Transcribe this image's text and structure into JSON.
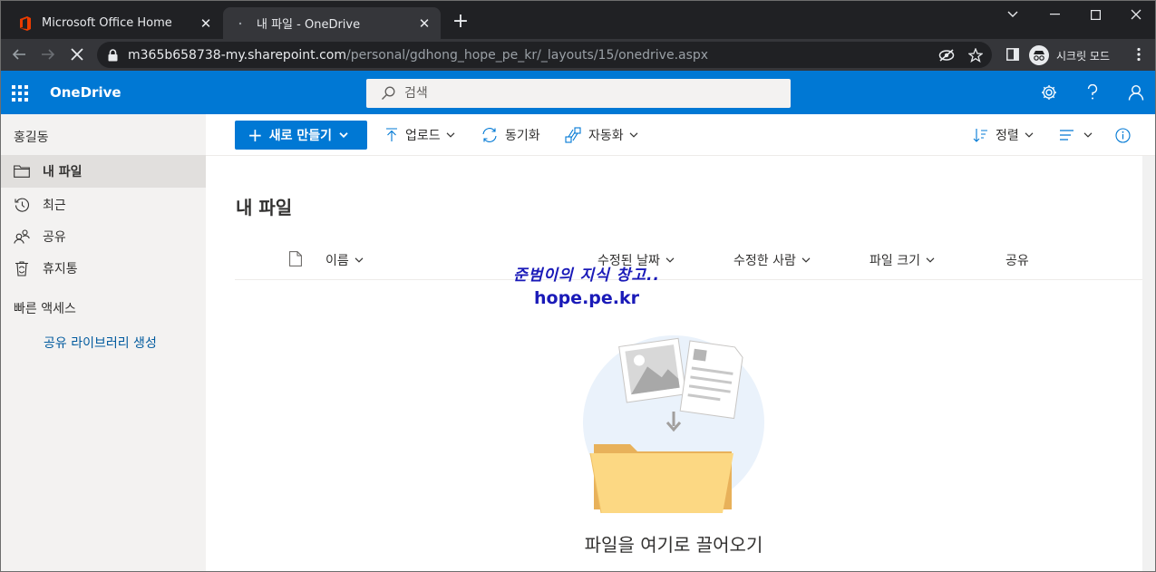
{
  "browser": {
    "tabs": [
      {
        "title": "Microsoft Office Home",
        "active": false
      },
      {
        "title": "내 파일 - OneDrive",
        "active": true
      }
    ],
    "url_host": "m365b658738-my.sharepoint.com",
    "url_path": "/personal/gdhong_hope_pe_kr/_layouts/15/onedrive.aspx",
    "incognito_label": "시크릿 모드"
  },
  "header": {
    "brand": "OneDrive",
    "search_placeholder": "검색",
    "accent": "#0078d4"
  },
  "sidebar": {
    "user": "홍길동",
    "items": [
      {
        "label": "내 파일",
        "icon": "folder-icon",
        "selected": true
      },
      {
        "label": "최근",
        "icon": "history-icon",
        "selected": false
      },
      {
        "label": "공유",
        "icon": "people-icon",
        "selected": false
      },
      {
        "label": "휴지통",
        "icon": "recycle-bin-icon",
        "selected": false
      }
    ],
    "quick_access": "빠른 액세스",
    "create_library": "공유 라이브러리 생성"
  },
  "commandbar": {
    "new": "새로 만들기",
    "upload": "업로드",
    "sync": "동기화",
    "automate": "자동화",
    "sort": "정렬"
  },
  "main": {
    "title": "내 파일",
    "columns": [
      "이름",
      "수정된 날짜",
      "수정한 사람",
      "파일 크기",
      "공유"
    ],
    "watermark_line1": "준범이의 지식 창고..",
    "watermark_line2": "hope.pe.kr",
    "empty_message": "파일을 여기로 끌어오기"
  }
}
